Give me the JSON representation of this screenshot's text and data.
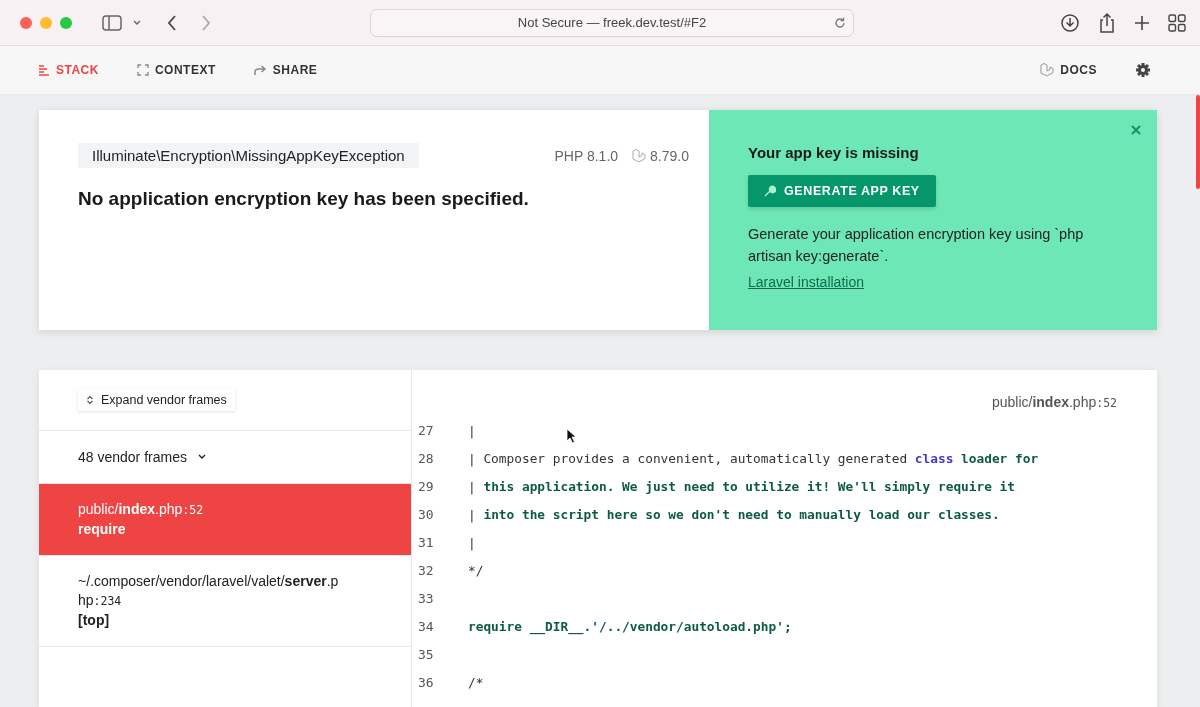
{
  "browser": {
    "address": "Not Secure — freek.dev.test/#F2"
  },
  "tabs": [
    {
      "label": "STACK",
      "selected": true
    },
    {
      "label": "CONTEXT",
      "selected": false
    },
    {
      "label": "SHARE",
      "selected": false
    }
  ],
  "docs": {
    "label": "DOCS"
  },
  "error": {
    "exception": "Illuminate\\Encryption\\MissingAppKeyException",
    "php_version": "PHP 8.1.0",
    "laravel_version": "8.79.0",
    "message": "No application encryption key has been specified."
  },
  "solution": {
    "title": "Your app key is missing",
    "button": "GENERATE APP KEY",
    "description": "Generate your application encryption key using `php artisan key:generate`.",
    "link": "Laravel installation"
  },
  "frames_header": {
    "button": "Expand vendor frames"
  },
  "frames": [
    {
      "kind": "vendor-group",
      "label": "48 vendor frames",
      "selected": false
    },
    {
      "kind": "frame",
      "path": "public/**index**.php",
      "line": ":52",
      "method": "require",
      "selected": true
    },
    {
      "kind": "frame",
      "path": "~/.composer/vendor/laravel/valet/**server**.php",
      "line": ":234",
      "method": "[top]",
      "selected": false
    }
  ],
  "code": {
    "file": "public/**index**.php",
    "line": ":52",
    "lines": [
      {
        "number": "27",
        "tokens": [
          {
            "kind": "plain",
            "text": "|"
          }
        ]
      },
      {
        "number": "28",
        "tokens": [
          {
            "kind": "plain",
            "text": "| Composer provides a convenient, automatically generated "
          },
          {
            "kind": "keyword",
            "text": "class"
          },
          {
            "kind": "comment",
            "text": " loader for"
          }
        ]
      },
      {
        "number": "29",
        "tokens": [
          {
            "kind": "plain",
            "text": "| "
          },
          {
            "kind": "comment",
            "text": "this application. We just need to utilize it! We'll simply require it"
          }
        ]
      },
      {
        "number": "30",
        "tokens": [
          {
            "kind": "plain",
            "text": "| "
          },
          {
            "kind": "comment",
            "text": "into the script here so we don't need to manually load our classes."
          }
        ]
      },
      {
        "number": "31",
        "tokens": [
          {
            "kind": "plain",
            "text": "|"
          }
        ]
      },
      {
        "number": "32",
        "tokens": [
          {
            "kind": "plain",
            "text": "*/"
          }
        ]
      },
      {
        "number": "33"
      },
      {
        "number": "34",
        "tokens": [
          {
            "kind": "comment",
            "text": "require __DIR__.'/../vendor/autoload.php';"
          }
        ]
      },
      {
        "number": "35"
      },
      {
        "number": "36",
        "tokens": [
          {
            "kind": "plain",
            "text": "/*"
          }
        ]
      }
    ]
  }
}
